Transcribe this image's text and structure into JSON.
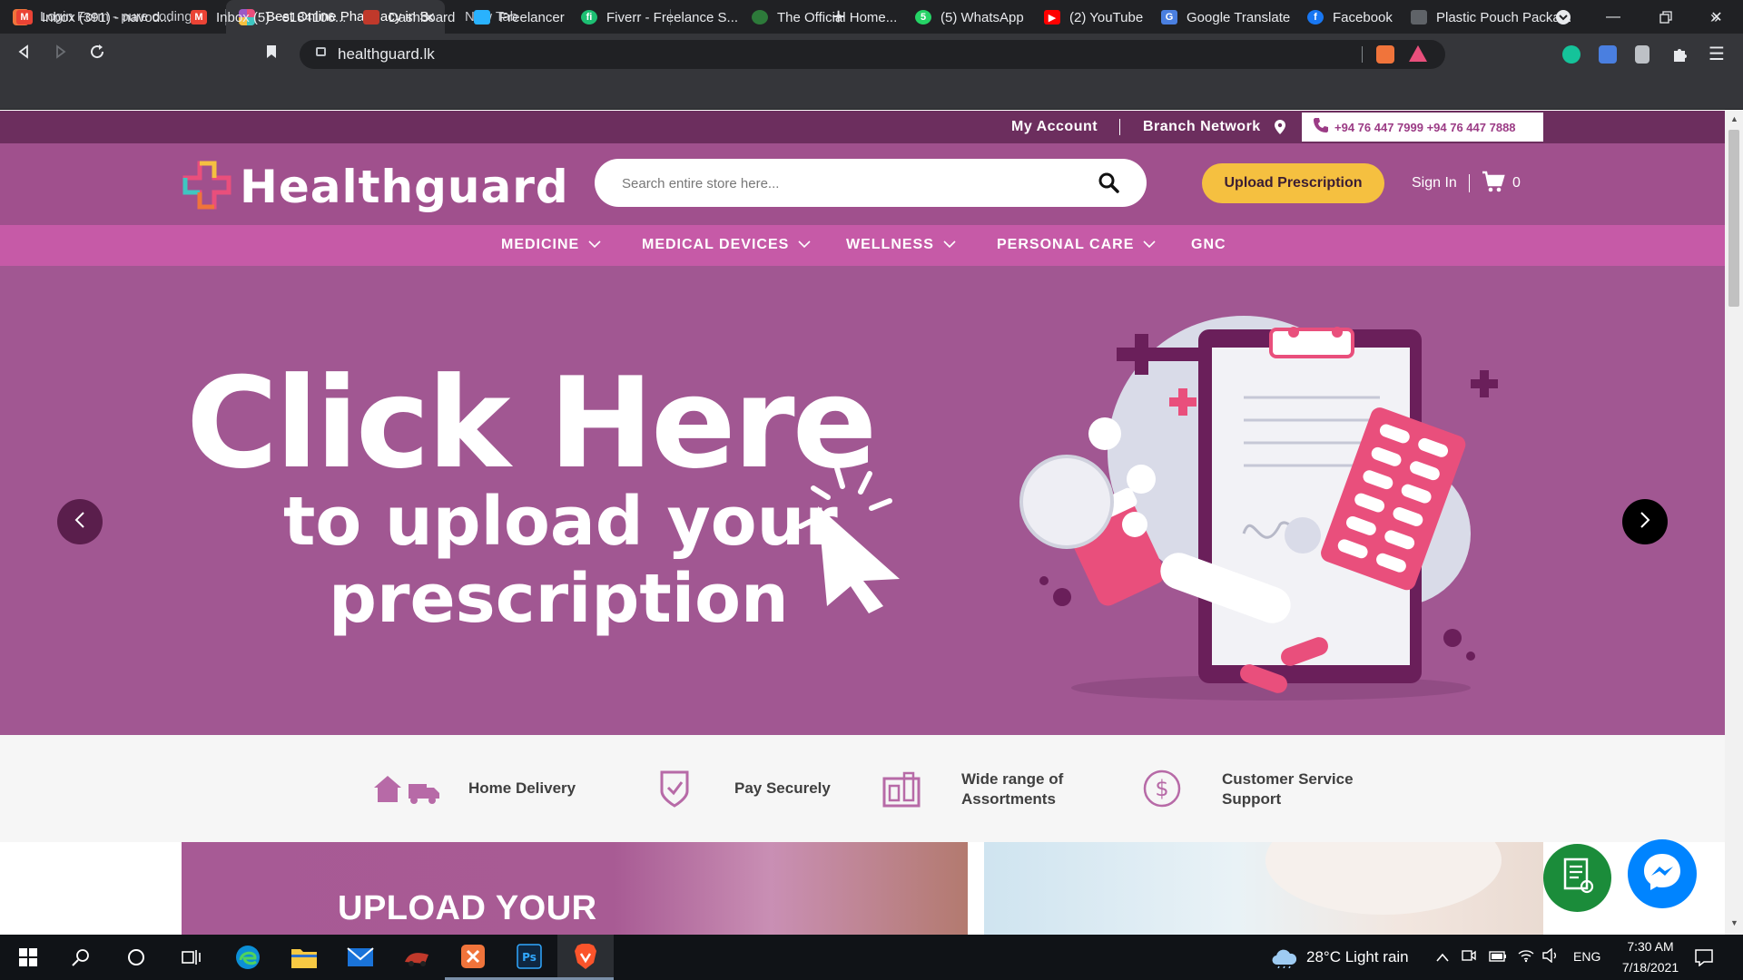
{
  "browser": {
    "tabs": [
      {
        "title": "Login Form - pure coding",
        "active": false
      },
      {
        "title": "Best Online Pharmacy in Sri Lanka",
        "active": true
      },
      {
        "title": "New Tab",
        "active": false
      }
    ],
    "url": "healthguard.lk",
    "bookmarks": [
      {
        "label": "Inbox (391) - navod...",
        "icon": "gmail-icon"
      },
      {
        "label": "Inbox (5) - e184106...",
        "icon": "gmail-icon"
      },
      {
        "label": "Dashboard",
        "icon": "dashboard-icon"
      },
      {
        "label": "Freelancer",
        "icon": "freelancer-icon"
      },
      {
        "label": "Fiverr - Freelance S...",
        "icon": "fiverr-icon"
      },
      {
        "label": "The Official Home...",
        "icon": "xampp-icon"
      },
      {
        "label": "(5) WhatsApp",
        "icon": "whatsapp-icon"
      },
      {
        "label": "(2) YouTube",
        "icon": "youtube-icon"
      },
      {
        "label": "Google Translate",
        "icon": "translate-icon"
      },
      {
        "label": "Facebook",
        "icon": "facebook-icon"
      },
      {
        "label": "Plastic Pouch Packa...",
        "icon": "pouch-icon"
      }
    ],
    "more_bookmarks": "»"
  },
  "site": {
    "topbar": {
      "my_account": "My Account",
      "branch_network": "Branch Network",
      "phone": "+94 76 447 7999 +94 76 447 7888"
    },
    "logo_text": "Healthguard",
    "search_placeholder": "Search entire store here...",
    "upload_button": "Upload Prescription",
    "sign_in": "Sign In",
    "cart_count": "0",
    "nav": [
      {
        "label": "MEDICINE",
        "dropdown": true
      },
      {
        "label": "MEDICAL DEVICES",
        "dropdown": true
      },
      {
        "label": "WELLNESS",
        "dropdown": true
      },
      {
        "label": "PERSONAL CARE",
        "dropdown": true
      },
      {
        "label": "GNC",
        "dropdown": false
      }
    ],
    "hero": {
      "line1": "Click Here",
      "line2": "to upload your",
      "line3": "prescription"
    },
    "features": [
      {
        "label": "Home Delivery",
        "icon": "home-delivery-icon"
      },
      {
        "label": "Pay Securely",
        "icon": "shield-check-icon"
      },
      {
        "label": "Wide range of Assortments",
        "line1": "Wide range of",
        "line2": "Assortments",
        "icon": "shelf-icon"
      },
      {
        "label": "Customer Service Support",
        "line1": "Customer Service",
        "line2": "Support",
        "icon": "dollar-circle-icon"
      }
    ],
    "promo_title": "UPLOAD YOUR"
  },
  "taskbar": {
    "weather": "28°C  Light rain",
    "language": "ENG",
    "time": "7:30 AM",
    "date": "7/18/2021"
  },
  "colors": {
    "brand_purple": "#a0508d",
    "nav_pink": "#c65aa7",
    "hero_bg": "#a15792",
    "topbar_dark": "#6c2e5e",
    "accent_yellow": "#f5c040"
  }
}
